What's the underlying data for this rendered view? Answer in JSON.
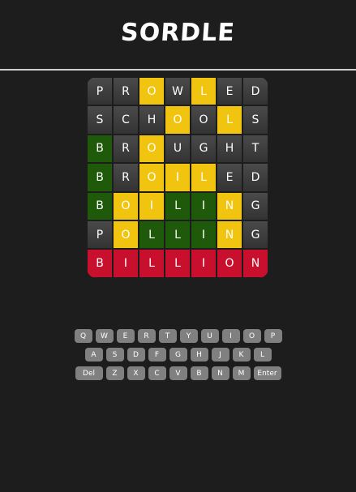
{
  "app": {
    "title": "SORDLE"
  },
  "colors": {
    "gray": "#3a3a3a",
    "yellow": "#f1c40f",
    "green": "#1e5a0a",
    "red": "#c8102e",
    "key": "#808080",
    "background": "#1d1d1d"
  },
  "board": {
    "rows": [
      {
        "letters": [
          "P",
          "R",
          "O",
          "W",
          "L",
          "E",
          "D"
        ],
        "states": [
          "gray",
          "gray",
          "yellow",
          "gray",
          "yellow",
          "gray",
          "gray"
        ]
      },
      {
        "letters": [
          "S",
          "C",
          "H",
          "O",
          "O",
          "L",
          "S"
        ],
        "states": [
          "gray",
          "gray",
          "gray",
          "yellow",
          "gray",
          "yellow",
          "gray"
        ]
      },
      {
        "letters": [
          "B",
          "R",
          "O",
          "U",
          "G",
          "H",
          "T"
        ],
        "states": [
          "green",
          "gray",
          "yellow",
          "gray",
          "gray",
          "gray",
          "gray"
        ]
      },
      {
        "letters": [
          "B",
          "R",
          "O",
          "I",
          "L",
          "E",
          "D"
        ],
        "states": [
          "green",
          "gray",
          "yellow",
          "yellow",
          "yellow",
          "gray",
          "gray"
        ]
      },
      {
        "letters": [
          "B",
          "O",
          "I",
          "L",
          "I",
          "N",
          "G"
        ],
        "states": [
          "green",
          "yellow",
          "yellow",
          "green",
          "green",
          "yellow",
          "gray"
        ]
      },
      {
        "letters": [
          "P",
          "O",
          "L",
          "L",
          "I",
          "N",
          "G"
        ],
        "states": [
          "gray",
          "yellow",
          "green",
          "green",
          "green",
          "yellow",
          "gray"
        ]
      },
      {
        "letters": [
          "B",
          "I",
          "L",
          "L",
          "I",
          "O",
          "N"
        ],
        "states": [
          "red",
          "red",
          "red",
          "red",
          "red",
          "red",
          "red"
        ]
      }
    ]
  },
  "keyboard": {
    "rows": [
      [
        "Q",
        "W",
        "E",
        "R",
        "T",
        "Y",
        "U",
        "I",
        "O",
        "P"
      ],
      [
        "A",
        "S",
        "D",
        "F",
        "G",
        "H",
        "J",
        "K",
        "L"
      ],
      [
        "Del",
        "Z",
        "X",
        "C",
        "V",
        "B",
        "N",
        "M",
        "Enter"
      ]
    ]
  }
}
